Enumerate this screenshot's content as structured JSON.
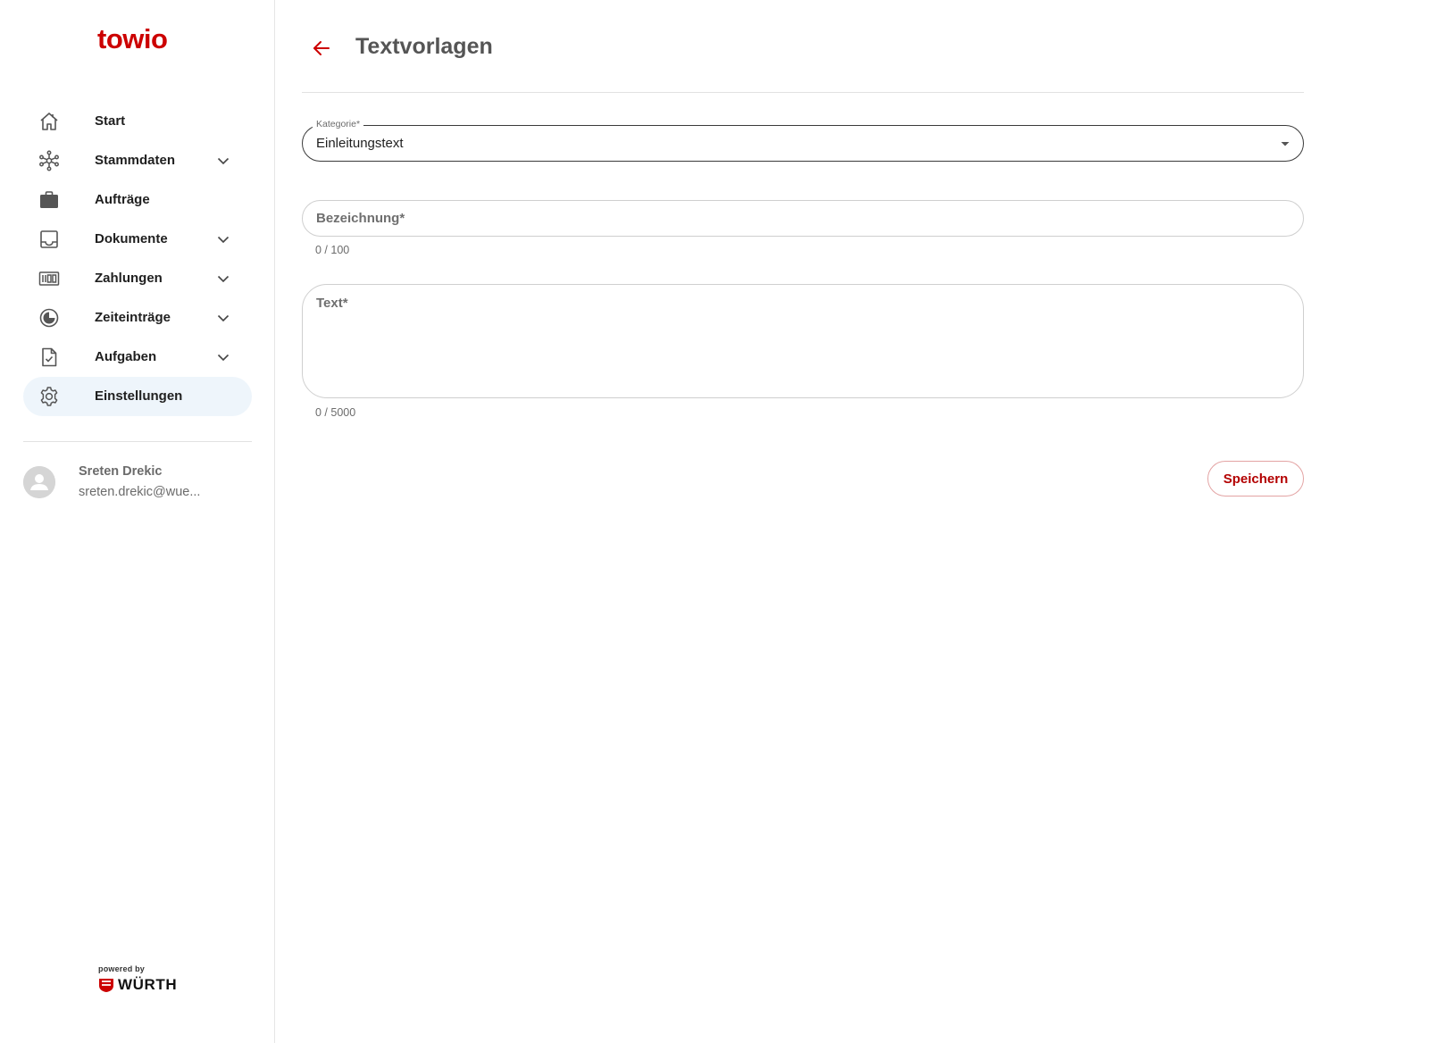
{
  "brand": {
    "logo_text": "towio",
    "accent_color": "#cc0000",
    "powered_by": "powered by",
    "partner": "WÜRTH"
  },
  "sidebar": {
    "items": [
      {
        "label": "Start",
        "icon": "home-icon",
        "expandable": false,
        "active": false
      },
      {
        "label": "Stammdaten",
        "icon": "network-icon",
        "expandable": true,
        "active": false
      },
      {
        "label": "Aufträge",
        "icon": "briefcase-icon",
        "expandable": false,
        "active": false
      },
      {
        "label": "Dokumente",
        "icon": "inbox-icon",
        "expandable": true,
        "active": false
      },
      {
        "label": "Zahlungen",
        "icon": "payments-icon",
        "expandable": true,
        "active": false
      },
      {
        "label": "Zeiteinträge",
        "icon": "clock-icon",
        "expandable": true,
        "active": false
      },
      {
        "label": "Aufgaben",
        "icon": "task-file-icon",
        "expandable": true,
        "active": false
      },
      {
        "label": "Einstellungen",
        "icon": "gear-icon",
        "expandable": false,
        "active": true
      }
    ],
    "user": {
      "name": "Sreten Drekic",
      "email": "sreten.drekic@wue..."
    }
  },
  "header": {
    "title": "Textvorlagen",
    "back_icon": "arrow-left-icon"
  },
  "form": {
    "kategorie": {
      "label": "Kategorie*",
      "value": "Einleitungstext"
    },
    "bezeichnung": {
      "placeholder": "Bezeichnung*",
      "value": "",
      "counter": "0 / 100"
    },
    "text": {
      "placeholder": "Text*",
      "value": "",
      "counter": "0 / 5000"
    },
    "save_label": "Speichern"
  }
}
